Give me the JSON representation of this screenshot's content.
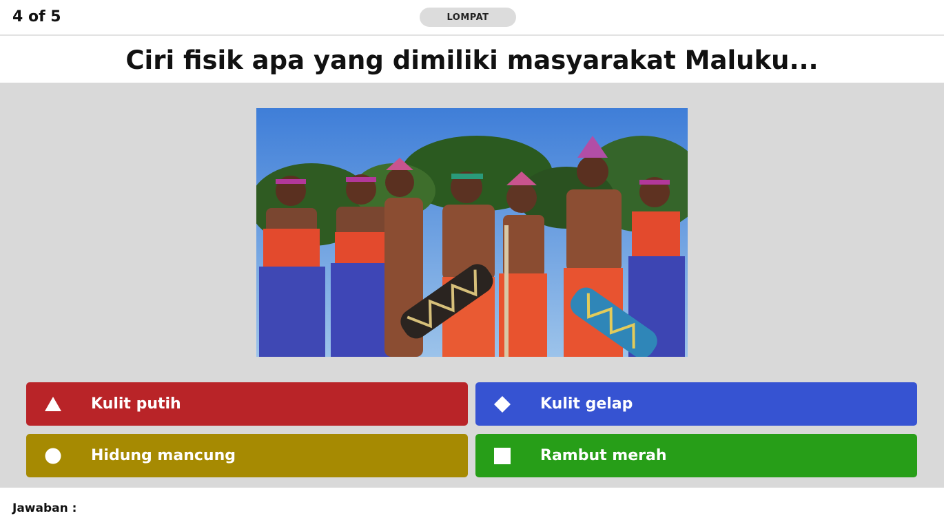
{
  "header": {
    "progress": "4 of 5",
    "skip_label": "LOMPAT"
  },
  "question": {
    "text": "Ciri fisik apa yang dimiliki masyarakat Maluku..."
  },
  "answers": [
    {
      "label": "Kulit putih",
      "icon": "triangle-icon",
      "color": "#b92428"
    },
    {
      "label": "Kulit gelap",
      "icon": "diamond-icon",
      "color": "#3653d2"
    },
    {
      "label": "Hidung mancung",
      "icon": "circle-icon",
      "color": "#a68a02"
    },
    {
      "label": "Rambut merah",
      "icon": "square-icon",
      "color": "#279e18"
    }
  ],
  "footer": {
    "answer_label": "Jawaban :"
  },
  "colors": {
    "stage_background": "#d9d9d9",
    "skip_button": "#dcdcdc"
  }
}
